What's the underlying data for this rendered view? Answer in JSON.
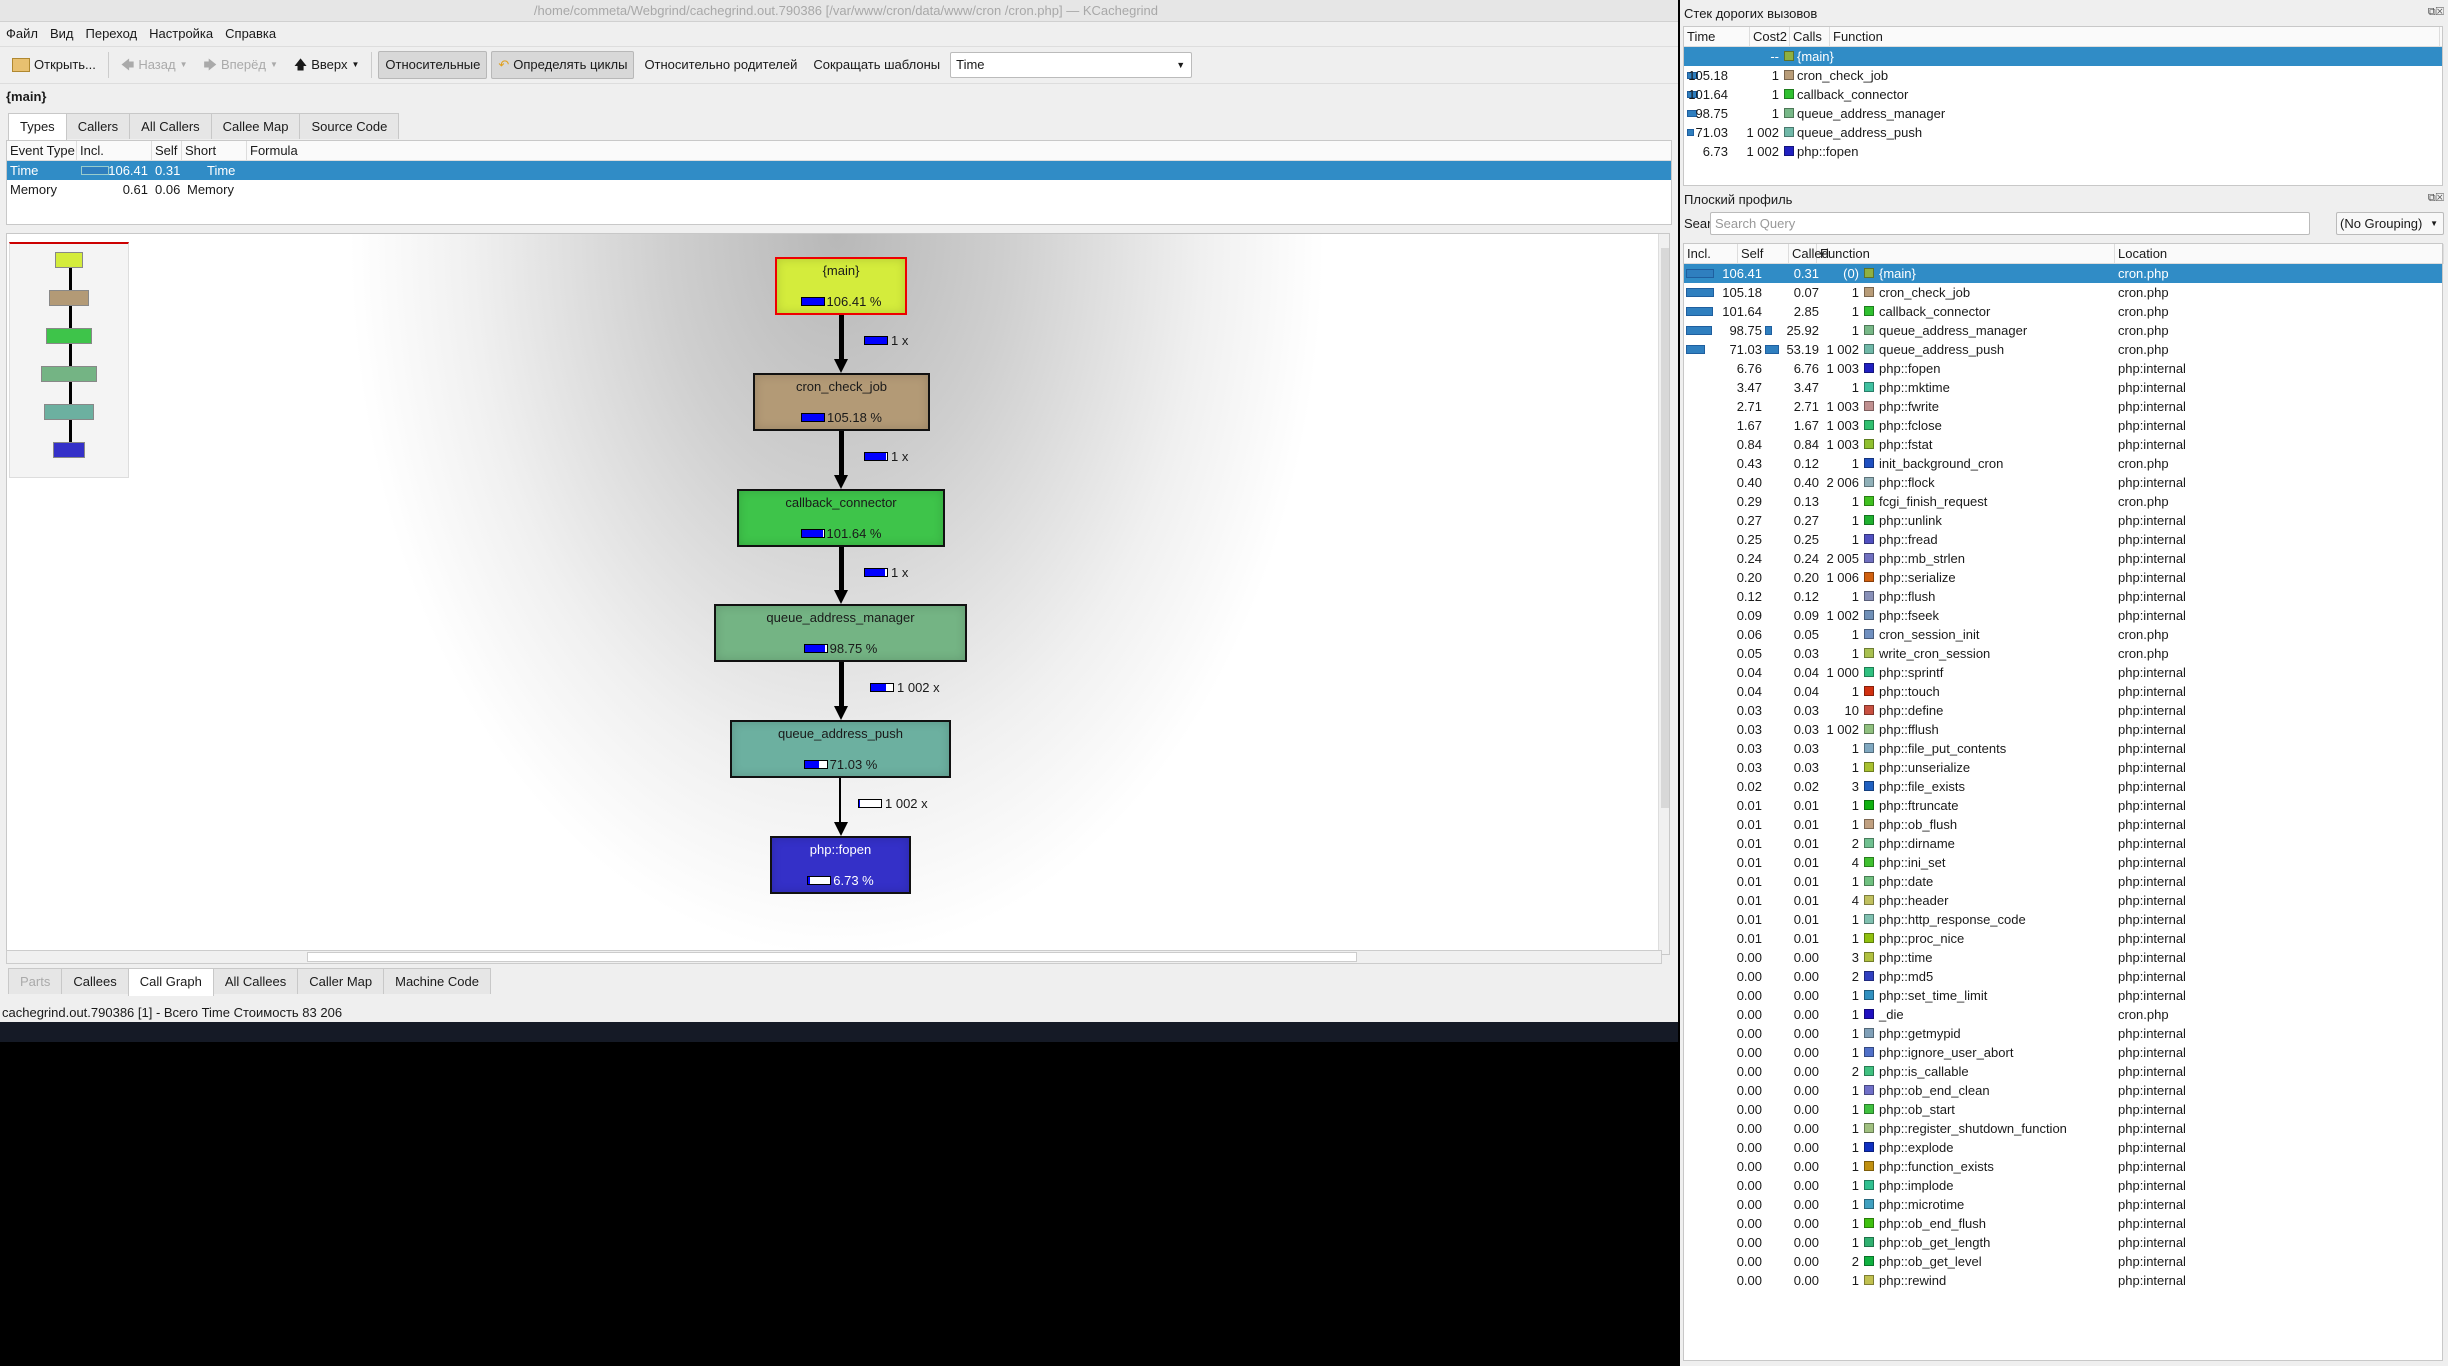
{
  "window": {
    "title": "/home/commeta/Webgrind/cachegrind.out.790386 [/var/www/cron/data/www/cron    /cron.php] — KCachegrind"
  },
  "menu": [
    "Файл",
    "Вид",
    "Переход",
    "Настройка",
    "Справка"
  ],
  "toolbar": {
    "open": "Открыть...",
    "back": "Назад",
    "forward": "Вперёд",
    "up": "Вверх",
    "relative": "Относительные",
    "cycles": "Определять циклы",
    "relative_parent": "Относительно родителей",
    "shorten": "Сокращать шаблоны",
    "event_type": "Time"
  },
  "current_function": "{main}",
  "top_tabs": [
    {
      "label": "Types",
      "active": true
    },
    {
      "label": "Callers"
    },
    {
      "label": "All Callers"
    },
    {
      "label": "Callee Map"
    },
    {
      "label": "Source Code"
    }
  ],
  "types_table": {
    "headers": [
      "Event Type",
      "Incl.",
      "Self",
      "Short",
      "Formula"
    ],
    "rows": [
      [
        "Time",
        "106.41",
        "0.31",
        "Time",
        ""
      ],
      [
        "Memory",
        "0.61",
        "0.06",
        "Memory",
        ""
      ]
    ]
  },
  "call_graph": {
    "nodes": [
      {
        "name": "{main}",
        "pct": "106.41 %",
        "value": 106.41,
        "color": "#d4ec3c",
        "current": true
      },
      {
        "name": "cron_check_job",
        "pct": "105.18 %",
        "value": 105.18,
        "color": "#b39a76"
      },
      {
        "name": "callback_connector",
        "pct": "101.64 %",
        "value": 101.64,
        "color": "#3ec44a"
      },
      {
        "name": "queue_address_manager",
        "pct": "98.75 %",
        "value": 98.75,
        "color": "#74b484"
      },
      {
        "name": "queue_address_push",
        "pct": "71.03 %",
        "value": 71.03,
        "color": "#6cb0a0"
      },
      {
        "name": "php::fopen",
        "pct": "6.73 %",
        "value": 6.73,
        "color": "#3430c8",
        "light": true
      }
    ],
    "edges": [
      {
        "label": "1 x",
        "value": 105.18
      },
      {
        "label": "1 x",
        "value": 101.64
      },
      {
        "label": "1 x",
        "value": 98.75
      },
      {
        "label": "1 002 x",
        "value": 71.03
      },
      {
        "label": "1 002 x",
        "value": 6.73
      }
    ]
  },
  "bottom_tabs": [
    {
      "label": "Parts",
      "disabled": true
    },
    {
      "label": "Callees"
    },
    {
      "label": "Call Graph",
      "active": true
    },
    {
      "label": "All Callees"
    },
    {
      "label": "Caller Map"
    },
    {
      "label": "Machine Code"
    }
  ],
  "status": "cachegrind.out.790386 [1] - Всего Time Стоимость 83 206",
  "stack_panel": {
    "title": "Стек дорогих вызовов",
    "headers": [
      "Time",
      "Cost2",
      "Calls",
      "Function"
    ],
    "rows": [
      [
        "",
        "",
        "--",
        "{main}",
        "#8fb040"
      ],
      [
        "105.18",
        "",
        "1",
        "cron_check_job",
        "#b89c78"
      ],
      [
        "101.64",
        "",
        "1",
        "callback_connector",
        "#30c030"
      ],
      [
        "98.75",
        "",
        "1",
        "queue_address_manager",
        "#78b888"
      ],
      [
        "71.03",
        "",
        "1 002",
        "queue_address_push",
        "#70b8a8"
      ],
      [
        "6.73",
        "",
        "1 002",
        "php::fopen",
        "#2020c0"
      ]
    ]
  },
  "flat_panel": {
    "title": "Плоский профиль",
    "search_label": "Search:",
    "search_placeholder": "Search Query",
    "grouping": "(No Grouping)",
    "headers": [
      "Incl.",
      "Self",
      "Called",
      "Function",
      "Location"
    ],
    "rows": [
      [
        "106.41",
        "0.31",
        "(0)",
        "{main}",
        "cron.php",
        "#8fb040"
      ],
      [
        "105.18",
        "0.07",
        "1",
        "cron_check_job",
        "cron.php",
        "#b89c78"
      ],
      [
        "101.64",
        "2.85",
        "1",
        "callback_connector",
        "cron.php",
        "#30c030"
      ],
      [
        "98.75",
        "25.92",
        "1",
        "queue_address_manager",
        "cron.php",
        "#78b888"
      ],
      [
        "71.03",
        "53.19",
        "1 002",
        "queue_address_push",
        "cron.php",
        "#70b8a8"
      ],
      [
        "6.76",
        "6.76",
        "1 003",
        "php::fopen",
        "php:internal",
        "#2020c0"
      ],
      [
        "3.47",
        "3.47",
        "1",
        "php::mktime",
        "php:internal",
        "#40c0a0"
      ],
      [
        "2.71",
        "2.71",
        "1 003",
        "php::fwrite",
        "php:internal",
        "#c09090"
      ],
      [
        "1.67",
        "1.67",
        "1 003",
        "php::fclose",
        "php:internal",
        "#30c070"
      ],
      [
        "0.84",
        "0.84",
        "1 003",
        "php::fstat",
        "php:internal",
        "#90c030"
      ],
      [
        "0.43",
        "0.12",
        "1",
        "init_background_cron",
        "cron.php",
        "#2050c0"
      ],
      [
        "0.40",
        "0.40",
        "2 006",
        "php::flock",
        "php:internal",
        "#90b0b8"
      ],
      [
        "0.29",
        "0.13",
        "1",
        "fcgi_finish_request",
        "cron.php",
        "#40c020"
      ],
      [
        "0.27",
        "0.27",
        "1",
        "php::unlink",
        "php:internal",
        "#20b030"
      ],
      [
        "0.25",
        "0.25",
        "1",
        "php::fread",
        "php:internal",
        "#5050c0"
      ],
      [
        "0.24",
        "0.24",
        "2 005",
        "php::mb_strlen",
        "php:internal",
        "#7070c0"
      ],
      [
        "0.20",
        "0.20",
        "1 006",
        "php::serialize",
        "php:internal",
        "#d06010"
      ],
      [
        "0.12",
        "0.12",
        "1",
        "php::flush",
        "php:internal",
        "#8890b8"
      ],
      [
        "0.09",
        "0.09",
        "1 002",
        "php::fseek",
        "php:internal",
        "#7090b8"
      ],
      [
        "0.06",
        "0.05",
        "1",
        "cron_session_init",
        "cron.php",
        "#7090c0"
      ],
      [
        "0.05",
        "0.03",
        "1",
        "write_cron_session",
        "cron.php",
        "#a8c050"
      ],
      [
        "0.04",
        "0.04",
        "1 000",
        "php::sprintf",
        "php:internal",
        "#30c080"
      ],
      [
        "0.04",
        "0.04",
        "1",
        "php::touch",
        "php:internal",
        "#d03010"
      ],
      [
        "0.03",
        "0.03",
        "10",
        "php::define",
        "php:internal",
        "#c85040"
      ],
      [
        "0.03",
        "0.03",
        "1 002",
        "php::fflush",
        "php:internal",
        "#90c080"
      ],
      [
        "0.03",
        "0.03",
        "1",
        "php::file_put_contents",
        "php:internal",
        "#80a8c0"
      ],
      [
        "0.03",
        "0.03",
        "1",
        "php::unserialize",
        "php:internal",
        "#a8c030"
      ],
      [
        "0.02",
        "0.02",
        "3",
        "php::file_exists",
        "php:internal",
        "#2060c0"
      ],
      [
        "0.01",
        "0.01",
        "1",
        "php::ftruncate",
        "php:internal",
        "#10b010"
      ],
      [
        "0.01",
        "0.01",
        "1",
        "php::ob_flush",
        "php:internal",
        "#c0a080"
      ],
      [
        "0.01",
        "0.01",
        "2",
        "php::dirname",
        "php:internal",
        "#70c090"
      ],
      [
        "0.01",
        "0.01",
        "4",
        "php::ini_set",
        "php:internal",
        "#40c030"
      ],
      [
        "0.01",
        "0.01",
        "1",
        "php::date",
        "php:internal",
        "#70c080"
      ],
      [
        "0.01",
        "0.01",
        "4",
        "php::header",
        "php:internal",
        "#c0c060"
      ],
      [
        "0.01",
        "0.01",
        "1",
        "php::http_response_code",
        "php:internal",
        "#80c0b0"
      ],
      [
        "0.01",
        "0.01",
        "1",
        "php::proc_nice",
        "php:internal",
        "#90c010"
      ],
      [
        "0.00",
        "0.00",
        "3",
        "php::time",
        "php:internal",
        "#b0c040"
      ],
      [
        "0.00",
        "0.00",
        "2",
        "php::md5",
        "php:internal",
        "#3040c0"
      ],
      [
        "0.00",
        "0.00",
        "1",
        "php::set_time_limit",
        "php:internal",
        "#3090c0"
      ],
      [
        "0.00",
        "0.00",
        "1",
        "_die",
        "cron.php",
        "#2010c0"
      ],
      [
        "0.00",
        "0.00",
        "1",
        "php::getmypid",
        "php:internal",
        "#80a0b8"
      ],
      [
        "0.00",
        "0.00",
        "1",
        "php::ignore_user_abort",
        "php:internal",
        "#5070c8"
      ],
      [
        "0.00",
        "0.00",
        "2",
        "php::is_callable",
        "php:internal",
        "#40c080"
      ],
      [
        "0.00",
        "0.00",
        "1",
        "php::ob_end_clean",
        "php:internal",
        "#7070c8"
      ],
      [
        "0.00",
        "0.00",
        "1",
        "php::ob_start",
        "php:internal",
        "#40c040"
      ],
      [
        "0.00",
        "0.00",
        "1",
        "php::register_shutdown_function",
        "php:internal",
        "#a0c080"
      ],
      [
        "0.00",
        "0.00",
        "1",
        "php::explode",
        "php:internal",
        "#1030c0"
      ],
      [
        "0.00",
        "0.00",
        "1",
        "php::function_exists",
        "php:internal",
        "#c09010"
      ],
      [
        "0.00",
        "0.00",
        "1",
        "php::implode",
        "php:internal",
        "#30c090"
      ],
      [
        "0.00",
        "0.00",
        "1",
        "php::microtime",
        "php:internal",
        "#40a0c0"
      ],
      [
        "0.00",
        "0.00",
        "1",
        "php::ob_end_flush",
        "php:internal",
        "#40c010"
      ],
      [
        "0.00",
        "0.00",
        "1",
        "php::ob_get_length",
        "php:internal",
        "#30b070"
      ],
      [
        "0.00",
        "0.00",
        "2",
        "php::ob_get_level",
        "php:internal",
        "#10b040"
      ],
      [
        "0.00",
        "0.00",
        "1",
        "php::rewind",
        "php:internal",
        "#c0c050"
      ]
    ]
  },
  "colors": {
    "selection": "#308cc6",
    "cost_bar": "#2f7fbf",
    "graph_bar": "#0000ff"
  }
}
